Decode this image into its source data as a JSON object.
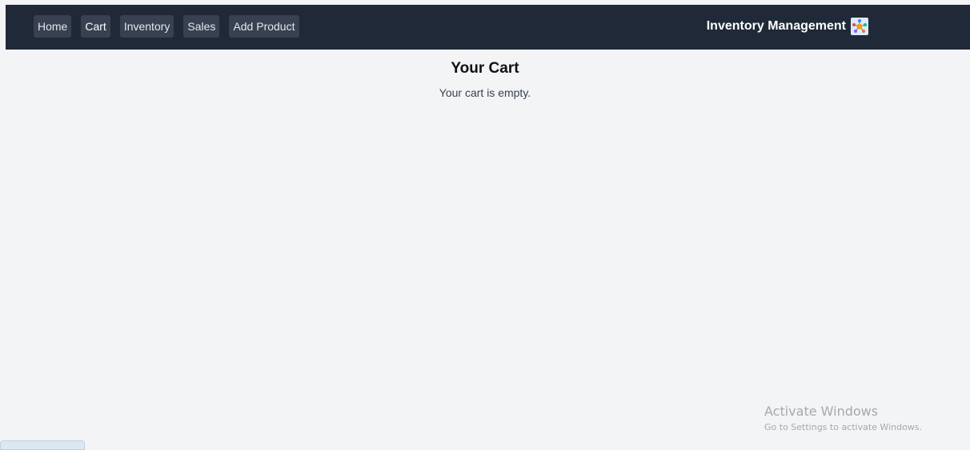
{
  "nav": {
    "links": [
      {
        "label": "Home"
      },
      {
        "label": "Cart"
      },
      {
        "label": "Inventory"
      },
      {
        "label": "Sales"
      },
      {
        "label": "Add Product"
      }
    ],
    "active": "Cart",
    "brand_title": "Inventory Management",
    "brand_icon": "inventory-network-icon"
  },
  "main": {
    "title": "Your Cart",
    "empty_message": "Your cart is empty."
  },
  "watermark": {
    "title": "Activate Windows",
    "subtitle": "Go to Settings to activate Windows."
  },
  "colors": {
    "navbar": "#1f2937",
    "nav_button": "#374151",
    "background": "#f3f4f6"
  }
}
